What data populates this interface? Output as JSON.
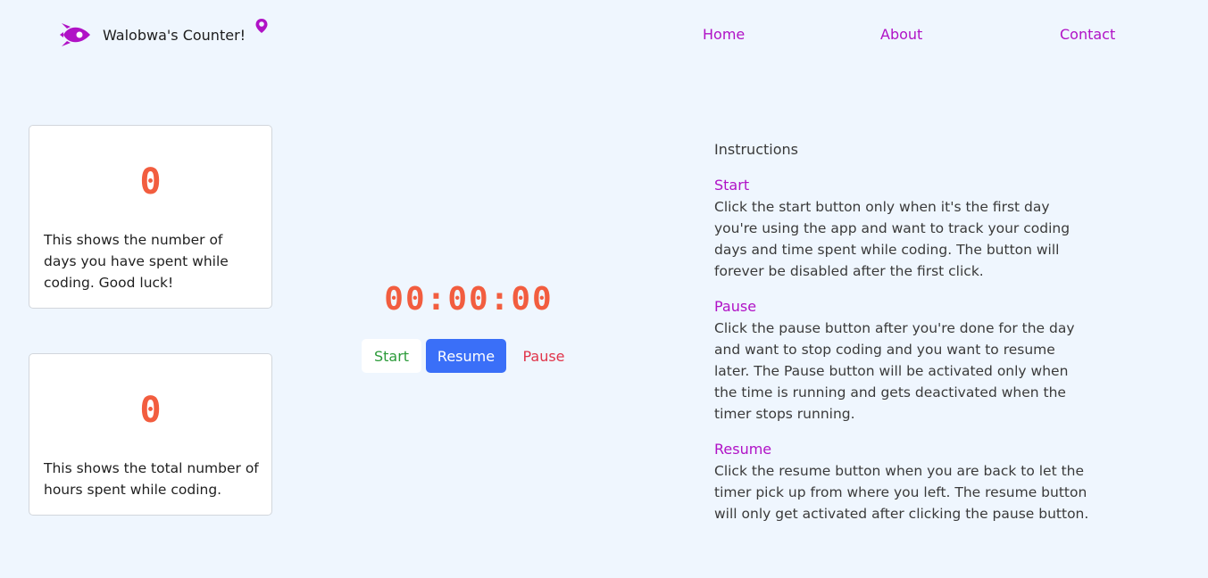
{
  "header": {
    "app_title": "Walobwa's Counter!",
    "nav": [
      "Home",
      "About",
      "Contact"
    ]
  },
  "colors": {
    "accent": "#b012c6",
    "counter": "#f25d3f",
    "background": "#eff6fe",
    "start": "#2c9b3a",
    "resume_bg": "#3a6ff8",
    "pause": "#e0344a"
  },
  "icons": {
    "logo": "rocket-icon",
    "badge": "map-pin-icon"
  },
  "cards": [
    {
      "value": "0",
      "description": "This shows the number of days you have spent while coding. Good luck!"
    },
    {
      "value": "0",
      "description": "This shows the total number of hours spent while coding."
    }
  ],
  "timer": {
    "display": "00:00:00",
    "buttons": {
      "start": "Start",
      "resume": "Resume",
      "pause": "Pause"
    }
  },
  "instructions": {
    "title": "Instructions",
    "sections": [
      {
        "title": "Start",
        "body": "Click the start button only when it's the first day you're using the app and want to track your coding days and time spent while coding. The button will forever be disabled after the first click."
      },
      {
        "title": "Pause",
        "body": "Click the pause button after you're done for the day and want to stop coding and you want to resume later. The Pause button will be activated only when the time is running and gets deactivated when the timer stops running."
      },
      {
        "title": "Resume",
        "body": "Click the resume button when you are back to let the timer pick up from where you left. The resume button will only get activated after clicking the pause button."
      }
    ]
  }
}
